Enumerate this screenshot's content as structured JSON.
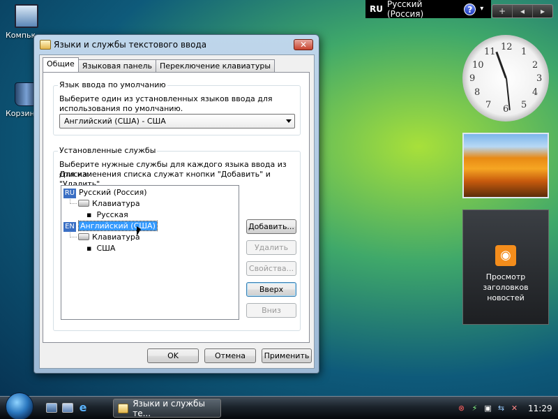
{
  "desktop": {
    "icons": [
      {
        "label": "Компьютер"
      },
      {
        "label": "Корзина"
      }
    ]
  },
  "sidebar": {
    "lang_badge": "RU",
    "lang_name": "Русский (Россия)",
    "help": "?",
    "controls": [
      "+",
      "◂",
      "▸"
    ],
    "clock_numbers": [
      "12",
      "1",
      "2",
      "3",
      "4",
      "5",
      "6",
      "7",
      "8",
      "9",
      "10",
      "11"
    ],
    "feed_label": "Просмотр заголовков новостей"
  },
  "dialog": {
    "title": "Языки и службы текстового ввода",
    "close": "✕",
    "tabs": [
      "Общие",
      "Языковая панель",
      "Переключение клавиатуры"
    ],
    "default_group": {
      "title": "Язык ввода по умолчанию",
      "description_1": "Выберите один из установленных языков ввода для",
      "description_2": "использования по умолчанию.",
      "selected": "Английский (США) - США"
    },
    "services_group": {
      "title": "Установленные службы",
      "description_1": "Выберите нужные службы для каждого языка ввода из списка.",
      "description_2": "Для изменения списка служат кнопки \"Добавить\" и \"Удалить\".",
      "tree": {
        "lang1_tag": "RU",
        "lang1": "Русский (Россия)",
        "lang1_kbd": "Клавиатура",
        "lang1_layout": "Русская",
        "lang2_tag": "EN",
        "lang2": "Английский (США)",
        "lang2_kbd": "Клавиатура",
        "lang2_layout": "США"
      },
      "buttons": {
        "add": "Добавить...",
        "remove": "Удалить",
        "properties": "Свойства...",
        "up": "Вверх",
        "down": "Вниз"
      }
    },
    "footer": {
      "ok": "OK",
      "cancel": "Отмена",
      "apply": "Применить"
    }
  },
  "taskbar": {
    "task_label": "Языки и службы тe...",
    "time": "11:29"
  }
}
